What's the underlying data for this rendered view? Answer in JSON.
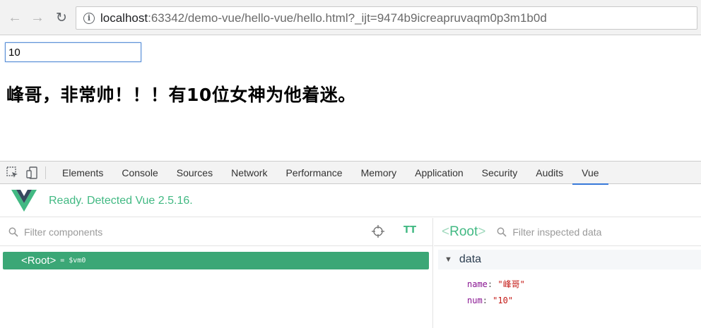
{
  "browser": {
    "url_host": "localhost",
    "url_rest": ":63342/demo-vue/hello-vue/hello.html?_ijt=9474b9icreapruvaqm0p3m1b0d"
  },
  "page": {
    "input_value": "10",
    "headline": "峰哥，非常帅！！！有10位女神为他着迷。"
  },
  "devtools": {
    "tabs": [
      "Elements",
      "Console",
      "Sources",
      "Network",
      "Performance",
      "Memory",
      "Application",
      "Security",
      "Audits",
      "Vue"
    ],
    "active_tab": "Vue"
  },
  "vue": {
    "status": "Ready. Detected Vue 2.5.16.",
    "filter_components_placeholder": "Filter components",
    "tt_label": "TT",
    "root_name": "Root",
    "root_vm": "= $vm0",
    "inspected_title": "Root",
    "filter_data_placeholder": "Filter inspected data",
    "data_section": "data",
    "props": [
      {
        "key": "name",
        "value": "\"峰哥\""
      },
      {
        "key": "num",
        "value": "\"10\""
      }
    ]
  },
  "colors": {
    "vue_green": "#42b983",
    "selected_row": "#3ba776",
    "active_tab_underline": "#3879d9"
  }
}
